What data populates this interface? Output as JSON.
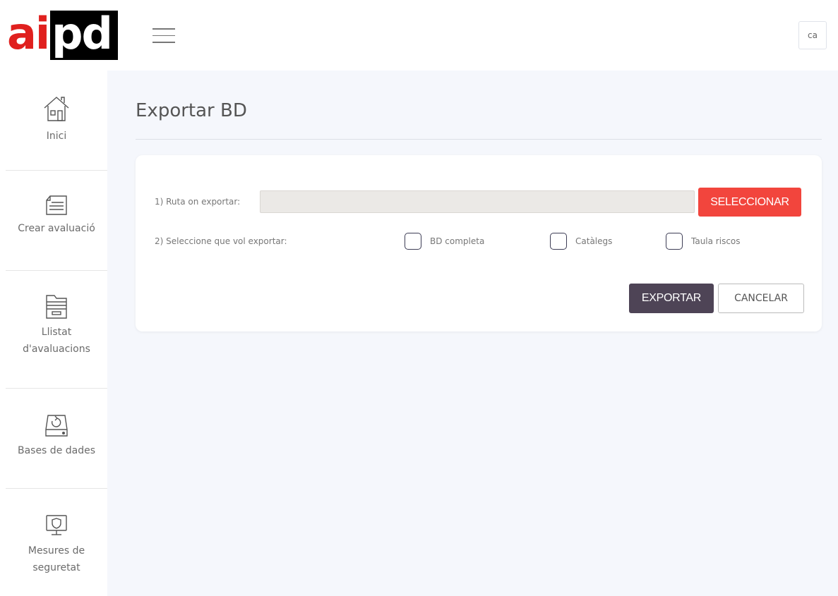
{
  "header": {
    "logo_part1": "ai",
    "logo_part2": "pd",
    "language": "ca"
  },
  "sidebar": {
    "items": [
      {
        "label": "Inici",
        "icon": "home-icon"
      },
      {
        "label": "Crear avaluació",
        "icon": "form-icon"
      },
      {
        "label": "Llistat d'avaluacions",
        "icon": "archive-icon"
      },
      {
        "label": "Bases de dades",
        "icon": "database-sync-icon"
      },
      {
        "label": "Mesures de seguretat",
        "icon": "monitor-shield-icon"
      }
    ]
  },
  "main": {
    "title": "Exportar BD",
    "route_label": "1) Ruta on exportar:",
    "route_value": "",
    "select_button": "SELECCIONAR",
    "options_label": "2) Seleccione que vol exportar:",
    "options": [
      {
        "label": "BD completa",
        "checked": false
      },
      {
        "label": "Catàlegs",
        "checked": false
      },
      {
        "label": "Taula riscos",
        "checked": false
      }
    ],
    "export_button": "EXPORTAR",
    "cancel_button": "CANCELAR"
  },
  "colors": {
    "logo_red": "#e0201e",
    "select_button": "#f2453d",
    "export_button": "#4e4456",
    "main_bg": "#f5f7fc"
  }
}
